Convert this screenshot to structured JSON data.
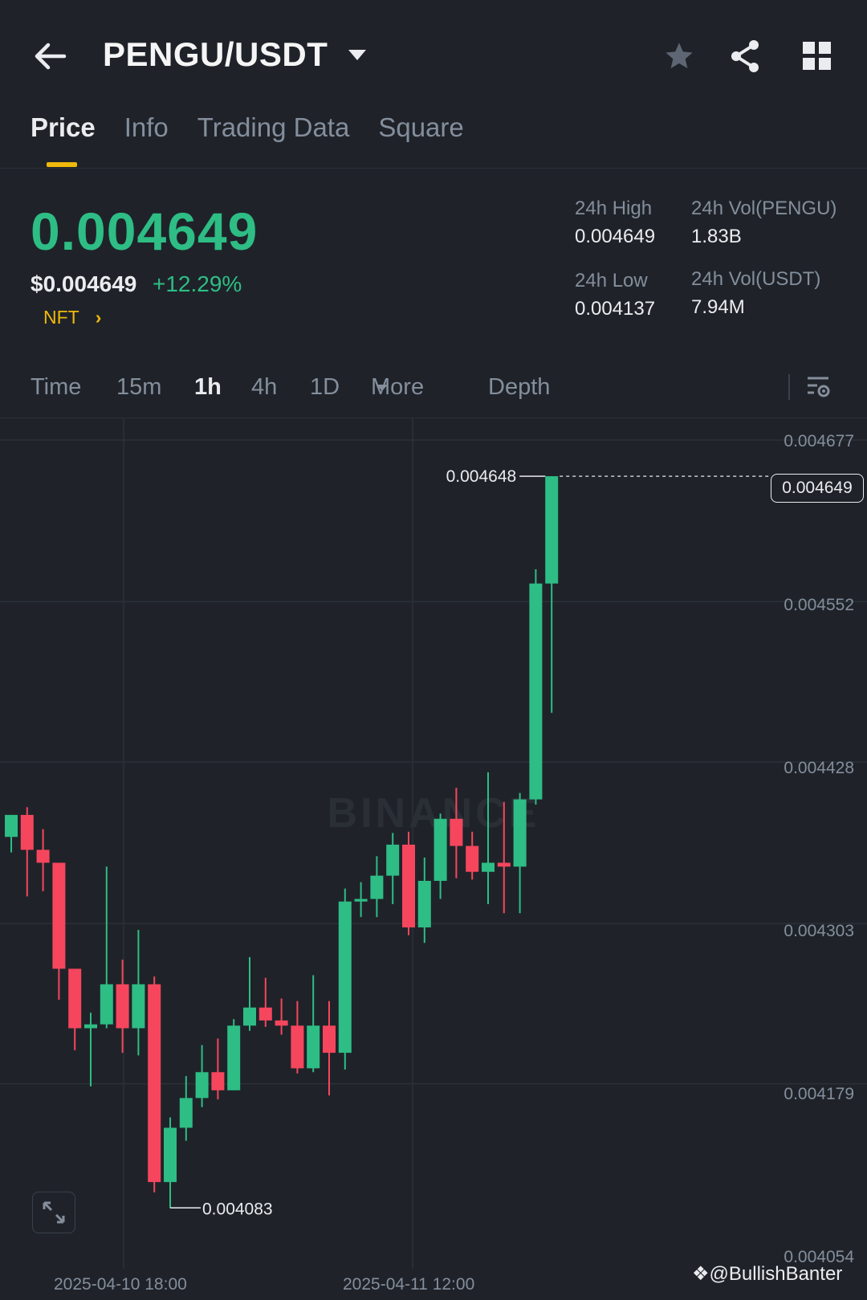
{
  "header": {
    "pair": "PENGU/USDT"
  },
  "tabs": [
    {
      "label": "Price",
      "active": true
    },
    {
      "label": "Info"
    },
    {
      "label": "Trading Data"
    },
    {
      "label": "Square"
    }
  ],
  "ticker": {
    "last_price": "0.004649",
    "usd_price": "$0.004649",
    "change": "+12.29%",
    "tag": "NFT",
    "high_label": "24h High",
    "high_value": "0.004649",
    "low_label": "24h Low",
    "low_value": "0.004137",
    "vol_base_label": "24h Vol(PENGU)",
    "vol_base_value": "1.83B",
    "vol_quote_label": "24h Vol(USDT)",
    "vol_quote_value": "7.94M"
  },
  "intervals": {
    "time": "Time",
    "m15": "15m",
    "h1": "1h",
    "h4": "4h",
    "d1": "1D",
    "more": "More",
    "depth": "Depth",
    "selected": "1h"
  },
  "colors": {
    "up": "#2ebd85",
    "down": "#f6465d",
    "accent": "#f0b90b",
    "background": "#1f2329"
  },
  "watermark": "BINANCE",
  "credit": "@BullishBanter",
  "chart_data": {
    "type": "candlestick",
    "y_tick_labels": [
      "0.004677",
      "0.004552",
      "0.004428",
      "0.004303",
      "0.004179",
      "0.004054"
    ],
    "x_tick_labels": [
      "2025-04-10 18:00",
      "2025-04-11 12:00"
    ],
    "ylim": [
      0.004054,
      0.004677
    ],
    "last_price_label": "0.004649",
    "high_marker": "0.004648",
    "low_marker": "0.004083",
    "grid": true,
    "candles": [
      {
        "o": 0.00437,
        "h": 0.004387,
        "l": 0.004358,
        "c": 0.004387
      },
      {
        "o": 0.004387,
        "h": 0.004393,
        "l": 0.004324,
        "c": 0.00436
      },
      {
        "o": 0.00436,
        "h": 0.004376,
        "l": 0.004328,
        "c": 0.00435
      },
      {
        "o": 0.00435,
        "h": 0.00435,
        "l": 0.004244,
        "c": 0.004268
      },
      {
        "o": 0.004268,
        "h": 0.004268,
        "l": 0.004205,
        "c": 0.004222
      },
      {
        "o": 0.004222,
        "h": 0.004234,
        "l": 0.004177,
        "c": 0.004225
      },
      {
        "o": 0.004225,
        "h": 0.004347,
        "l": 0.004222,
        "c": 0.004256
      },
      {
        "o": 0.004256,
        "h": 0.004275,
        "l": 0.004203,
        "c": 0.004222
      },
      {
        "o": 0.004222,
        "h": 0.004298,
        "l": 0.004201,
        "c": 0.004256
      },
      {
        "o": 0.004256,
        "h": 0.004262,
        "l": 0.004095,
        "c": 0.004103
      },
      {
        "o": 0.004103,
        "h": 0.004153,
        "l": 0.004083,
        "c": 0.004145
      },
      {
        "o": 0.004145,
        "h": 0.004185,
        "l": 0.004135,
        "c": 0.004168
      },
      {
        "o": 0.004168,
        "h": 0.004209,
        "l": 0.004161,
        "c": 0.004188
      },
      {
        "o": 0.004188,
        "h": 0.004214,
        "l": 0.004167,
        "c": 0.004174
      },
      {
        "o": 0.004174,
        "h": 0.004229,
        "l": 0.004174,
        "c": 0.004224
      },
      {
        "o": 0.004224,
        "h": 0.004277,
        "l": 0.00422,
        "c": 0.004238
      },
      {
        "o": 0.004238,
        "h": 0.004261,
        "l": 0.004223,
        "c": 0.004228
      },
      {
        "o": 0.004228,
        "h": 0.004245,
        "l": 0.004217,
        "c": 0.004224
      },
      {
        "o": 0.004224,
        "h": 0.004243,
        "l": 0.004187,
        "c": 0.004191
      },
      {
        "o": 0.004191,
        "h": 0.004263,
        "l": 0.004188,
        "c": 0.004224
      },
      {
        "o": 0.004224,
        "h": 0.004243,
        "l": 0.00417,
        "c": 0.004203
      },
      {
        "o": 0.004203,
        "h": 0.00433,
        "l": 0.00419,
        "c": 0.00432
      },
      {
        "o": 0.00432,
        "h": 0.004335,
        "l": 0.004308,
        "c": 0.004322
      },
      {
        "o": 0.004322,
        "h": 0.004355,
        "l": 0.004308,
        "c": 0.00434
      },
      {
        "o": 0.00434,
        "h": 0.004373,
        "l": 0.004318,
        "c": 0.004364
      },
      {
        "o": 0.004364,
        "h": 0.004374,
        "l": 0.004294,
        "c": 0.0043
      },
      {
        "o": 0.0043,
        "h": 0.004354,
        "l": 0.004288,
        "c": 0.004336
      },
      {
        "o": 0.004336,
        "h": 0.004388,
        "l": 0.004322,
        "c": 0.004384
      },
      {
        "o": 0.004384,
        "h": 0.004408,
        "l": 0.004338,
        "c": 0.004363
      },
      {
        "o": 0.004363,
        "h": 0.004374,
        "l": 0.004337,
        "c": 0.004343
      },
      {
        "o": 0.004343,
        "h": 0.00442,
        "l": 0.004318,
        "c": 0.00435
      },
      {
        "o": 0.00435,
        "h": 0.004397,
        "l": 0.004311,
        "c": 0.004347
      },
      {
        "o": 0.004347,
        "h": 0.004404,
        "l": 0.004311,
        "c": 0.004399
      },
      {
        "o": 0.004399,
        "h": 0.004577,
        "l": 0.004395,
        "c": 0.004566
      },
      {
        "o": 0.004566,
        "h": 0.004649,
        "l": 0.004466,
        "c": 0.004649
      }
    ]
  }
}
